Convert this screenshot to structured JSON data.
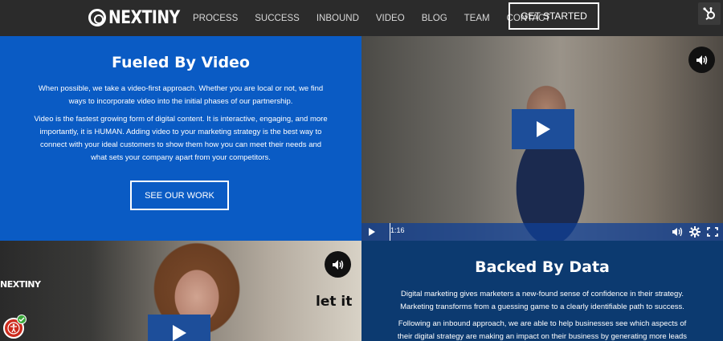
{
  "nav": {
    "logo_text": "NEXTINY",
    "links": [
      "PROCESS",
      "SUCCESS",
      "INBOUND",
      "VIDEO",
      "BLOG",
      "TEAM",
      "CONTACT"
    ],
    "cta_label": "GET STARTED"
  },
  "fueled": {
    "title": "Fueled By Video",
    "para1": "When possible, we take a video-first approach. Whether you are local or not, we find ways to incorporate video into the initial phases of our partnership.",
    "para2": "Video is the fastest growing form of digital content. It is interactive, engaging, and more importantly, it is HUMAN. Adding video to your marketing strategy is the best way to connect with your ideal customers to show them how you can meet their needs and what sets your company apart from your competitors.",
    "button_label": "SEE OUR WORK"
  },
  "video1": {
    "time": "1:16",
    "progress": 0.01
  },
  "video2": {
    "wall_logo": "NEXTINY",
    "wall_sign": "let it"
  },
  "backed": {
    "title": "Backed By Data",
    "para1": "Digital marketing gives marketers a new-found sense of confidence in their strategy. Marketing transforms from a guessing game to a clearly identifiable path to success.",
    "para2": "Following an inbound approach, we are able to help businesses see which aspects of their digital strategy are making an impact on their business by generating more leads and"
  },
  "colors": {
    "nav_bg": "#2b2b2b",
    "blue": "#0a5bc4",
    "navy": "#0c3a70",
    "play_blue": "#1d4e9a"
  }
}
